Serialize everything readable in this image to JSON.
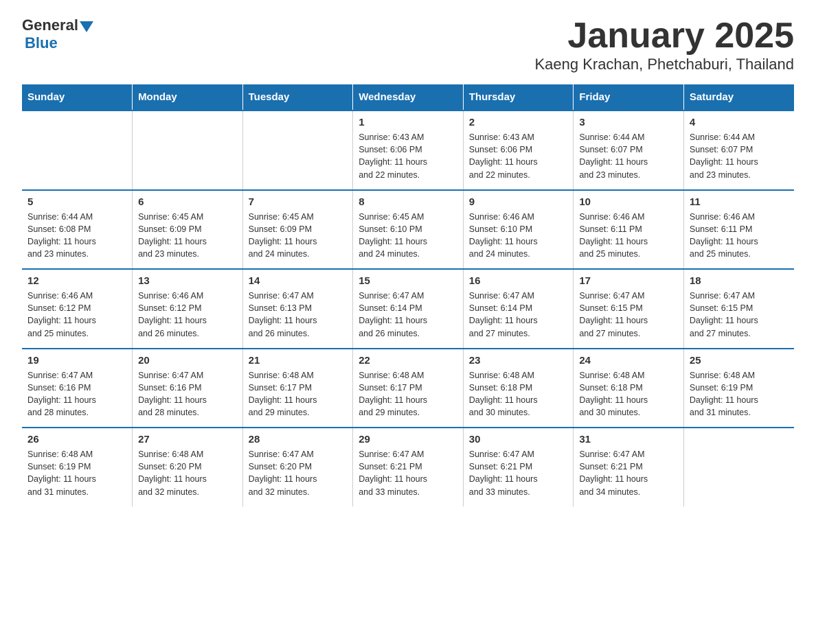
{
  "logo": {
    "general": "General",
    "blue": "Blue"
  },
  "title": "January 2025",
  "subtitle": "Kaeng Krachan, Phetchaburi, Thailand",
  "weekdays": [
    "Sunday",
    "Monday",
    "Tuesday",
    "Wednesday",
    "Thursday",
    "Friday",
    "Saturday"
  ],
  "weeks": [
    [
      {
        "day": "",
        "info": ""
      },
      {
        "day": "",
        "info": ""
      },
      {
        "day": "",
        "info": ""
      },
      {
        "day": "1",
        "info": "Sunrise: 6:43 AM\nSunset: 6:06 PM\nDaylight: 11 hours\nand 22 minutes."
      },
      {
        "day": "2",
        "info": "Sunrise: 6:43 AM\nSunset: 6:06 PM\nDaylight: 11 hours\nand 22 minutes."
      },
      {
        "day": "3",
        "info": "Sunrise: 6:44 AM\nSunset: 6:07 PM\nDaylight: 11 hours\nand 23 minutes."
      },
      {
        "day": "4",
        "info": "Sunrise: 6:44 AM\nSunset: 6:07 PM\nDaylight: 11 hours\nand 23 minutes."
      }
    ],
    [
      {
        "day": "5",
        "info": "Sunrise: 6:44 AM\nSunset: 6:08 PM\nDaylight: 11 hours\nand 23 minutes."
      },
      {
        "day": "6",
        "info": "Sunrise: 6:45 AM\nSunset: 6:09 PM\nDaylight: 11 hours\nand 23 minutes."
      },
      {
        "day": "7",
        "info": "Sunrise: 6:45 AM\nSunset: 6:09 PM\nDaylight: 11 hours\nand 24 minutes."
      },
      {
        "day": "8",
        "info": "Sunrise: 6:45 AM\nSunset: 6:10 PM\nDaylight: 11 hours\nand 24 minutes."
      },
      {
        "day": "9",
        "info": "Sunrise: 6:46 AM\nSunset: 6:10 PM\nDaylight: 11 hours\nand 24 minutes."
      },
      {
        "day": "10",
        "info": "Sunrise: 6:46 AM\nSunset: 6:11 PM\nDaylight: 11 hours\nand 25 minutes."
      },
      {
        "day": "11",
        "info": "Sunrise: 6:46 AM\nSunset: 6:11 PM\nDaylight: 11 hours\nand 25 minutes."
      }
    ],
    [
      {
        "day": "12",
        "info": "Sunrise: 6:46 AM\nSunset: 6:12 PM\nDaylight: 11 hours\nand 25 minutes."
      },
      {
        "day": "13",
        "info": "Sunrise: 6:46 AM\nSunset: 6:12 PM\nDaylight: 11 hours\nand 26 minutes."
      },
      {
        "day": "14",
        "info": "Sunrise: 6:47 AM\nSunset: 6:13 PM\nDaylight: 11 hours\nand 26 minutes."
      },
      {
        "day": "15",
        "info": "Sunrise: 6:47 AM\nSunset: 6:14 PM\nDaylight: 11 hours\nand 26 minutes."
      },
      {
        "day": "16",
        "info": "Sunrise: 6:47 AM\nSunset: 6:14 PM\nDaylight: 11 hours\nand 27 minutes."
      },
      {
        "day": "17",
        "info": "Sunrise: 6:47 AM\nSunset: 6:15 PM\nDaylight: 11 hours\nand 27 minutes."
      },
      {
        "day": "18",
        "info": "Sunrise: 6:47 AM\nSunset: 6:15 PM\nDaylight: 11 hours\nand 27 minutes."
      }
    ],
    [
      {
        "day": "19",
        "info": "Sunrise: 6:47 AM\nSunset: 6:16 PM\nDaylight: 11 hours\nand 28 minutes."
      },
      {
        "day": "20",
        "info": "Sunrise: 6:47 AM\nSunset: 6:16 PM\nDaylight: 11 hours\nand 28 minutes."
      },
      {
        "day": "21",
        "info": "Sunrise: 6:48 AM\nSunset: 6:17 PM\nDaylight: 11 hours\nand 29 minutes."
      },
      {
        "day": "22",
        "info": "Sunrise: 6:48 AM\nSunset: 6:17 PM\nDaylight: 11 hours\nand 29 minutes."
      },
      {
        "day": "23",
        "info": "Sunrise: 6:48 AM\nSunset: 6:18 PM\nDaylight: 11 hours\nand 30 minutes."
      },
      {
        "day": "24",
        "info": "Sunrise: 6:48 AM\nSunset: 6:18 PM\nDaylight: 11 hours\nand 30 minutes."
      },
      {
        "day": "25",
        "info": "Sunrise: 6:48 AM\nSunset: 6:19 PM\nDaylight: 11 hours\nand 31 minutes."
      }
    ],
    [
      {
        "day": "26",
        "info": "Sunrise: 6:48 AM\nSunset: 6:19 PM\nDaylight: 11 hours\nand 31 minutes."
      },
      {
        "day": "27",
        "info": "Sunrise: 6:48 AM\nSunset: 6:20 PM\nDaylight: 11 hours\nand 32 minutes."
      },
      {
        "day": "28",
        "info": "Sunrise: 6:47 AM\nSunset: 6:20 PM\nDaylight: 11 hours\nand 32 minutes."
      },
      {
        "day": "29",
        "info": "Sunrise: 6:47 AM\nSunset: 6:21 PM\nDaylight: 11 hours\nand 33 minutes."
      },
      {
        "day": "30",
        "info": "Sunrise: 6:47 AM\nSunset: 6:21 PM\nDaylight: 11 hours\nand 33 minutes."
      },
      {
        "day": "31",
        "info": "Sunrise: 6:47 AM\nSunset: 6:21 PM\nDaylight: 11 hours\nand 34 minutes."
      },
      {
        "day": "",
        "info": ""
      }
    ]
  ]
}
